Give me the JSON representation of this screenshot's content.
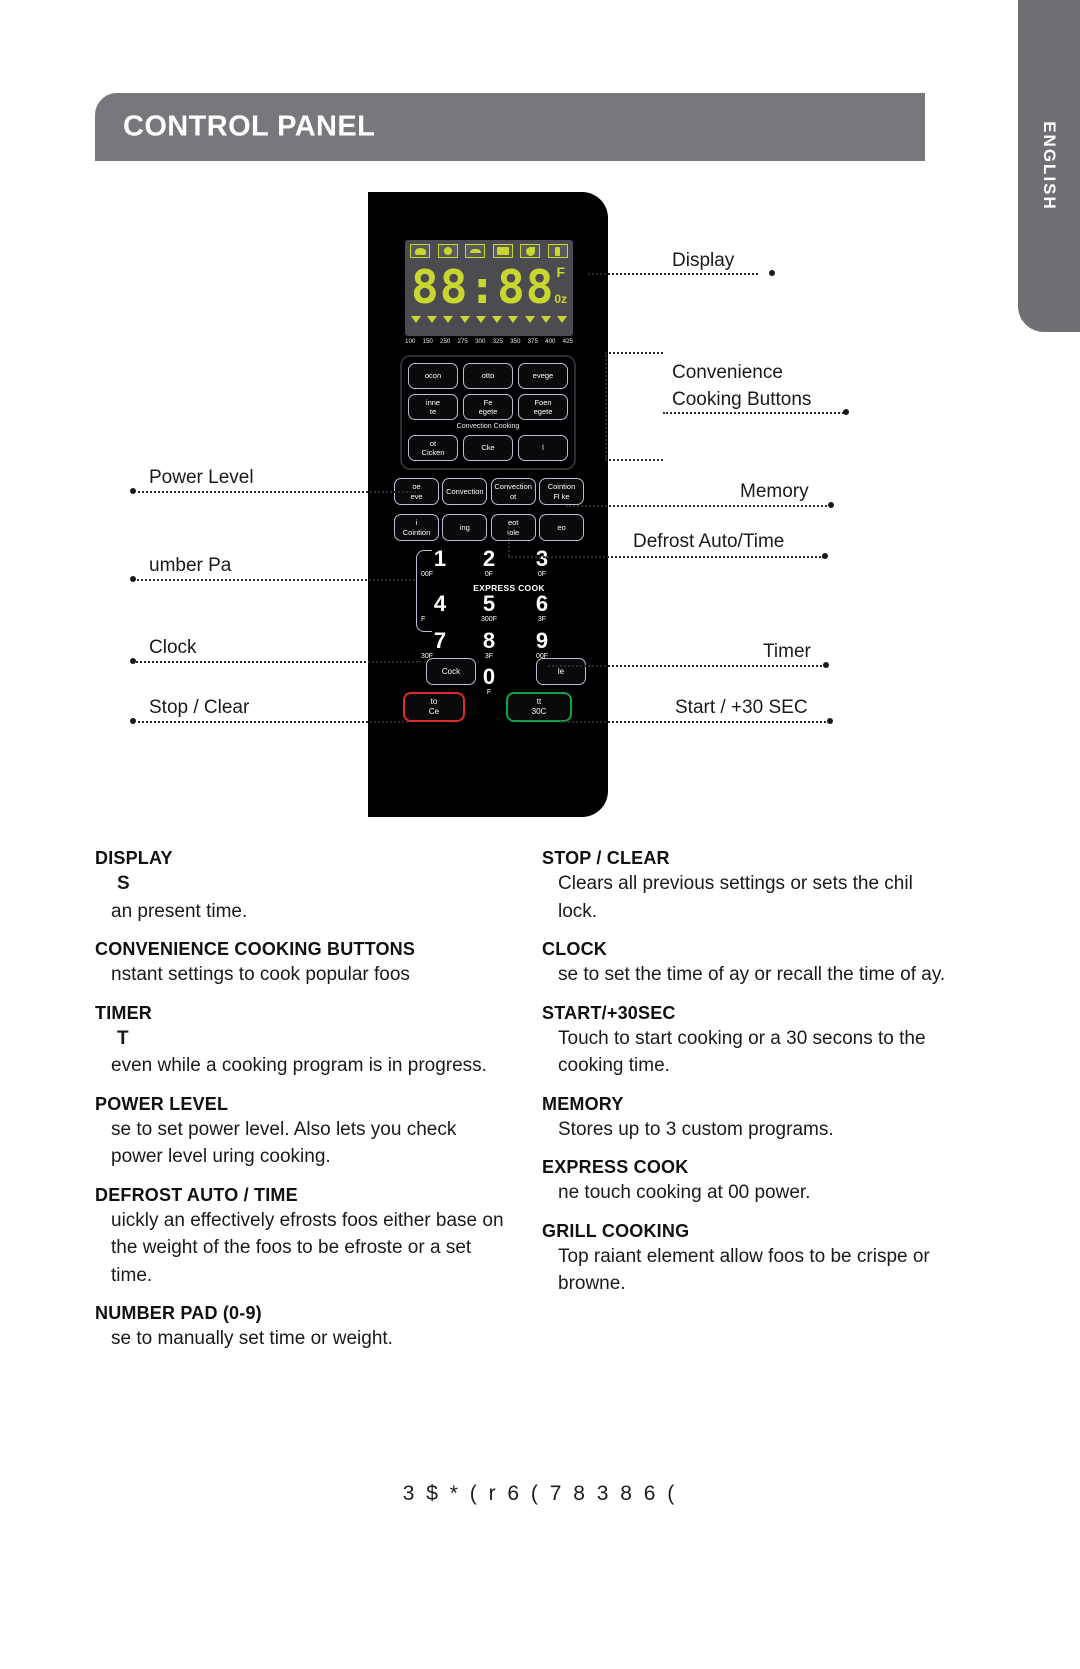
{
  "language_tab": {
    "label": "ENGLISH"
  },
  "header": {
    "title": "CONTROL PANEL"
  },
  "panel": {
    "display": {
      "digits": "88:88",
      "unit_f": "F",
      "unit_oz": "0z",
      "temp_scale": [
        "100",
        "150",
        "250",
        "275",
        "300",
        "325",
        "350",
        "375",
        "400",
        "425"
      ],
      "status_icons": [
        "popcorn-icon",
        "potato-icon",
        "pizza-icon",
        "reheat-icon",
        "beverage-icon",
        "defrost-icon"
      ]
    },
    "convenience_buttons": [
      {
        "line1": "ocon",
        "line2": ""
      },
      {
        "line1": "otto",
        "line2": ""
      },
      {
        "line1": "evege",
        "line2": ""
      },
      {
        "line1": "inne",
        "line2": "te"
      },
      {
        "line1": "Fe",
        "line2": "egete"
      },
      {
        "line1": "Foen",
        "line2": "egete"
      },
      {
        "line1": "ot",
        "line2": "Cicken"
      },
      {
        "line1": "Cke",
        "line2": ""
      },
      {
        "line1": "l",
        "line2": ""
      }
    ],
    "convenience_caption": "Convection Cooking",
    "mid_row_1": [
      {
        "line1": "oe",
        "line2": "eve"
      },
      {
        "line1": "Convection",
        "line2": ""
      },
      {
        "line1": "Convection",
        "line2": "ot"
      },
      {
        "line1": "Cointion",
        "line2": "Fl ke"
      }
    ],
    "mid_row_2": [
      {
        "line1": "i",
        "line2": "Cointion"
      },
      {
        "line1": "ing",
        "line2": ""
      },
      {
        "line1": "eot",
        "line2": "tole"
      },
      {
        "line1": "eo",
        "line2": ""
      }
    ],
    "numpad": [
      {
        "digit": "1",
        "sub": "00F"
      },
      {
        "digit": "2",
        "sub": "0F"
      },
      {
        "digit": "3",
        "sub": "0F"
      },
      {
        "digit": "4",
        "sub": "F"
      },
      {
        "digit": "5",
        "sub": "300F"
      },
      {
        "digit": "6",
        "sub": "3F"
      },
      {
        "digit": "7",
        "sub": "30F"
      },
      {
        "digit": "8",
        "sub": "3F"
      },
      {
        "digit": "9",
        "sub": "00F"
      },
      {
        "digit": "0",
        "sub": "F"
      }
    ],
    "express_cook_label": "EXPRESS COOK",
    "clock_button": "Cock",
    "timer_button": "le",
    "stop_clear_button": {
      "line1": "to",
      "line2": "Ce"
    },
    "start_button": {
      "line1": "tt",
      "line2": "30C"
    }
  },
  "callouts": {
    "display": "Display",
    "convenience_1": "Convenience",
    "convenience_2": "Cooking Buttons",
    "power_level": "Power Level",
    "memory": "Memory",
    "number_pad": "umber Pa",
    "defrost": "Defrost Auto/Time",
    "clock": "Clock",
    "timer": "Timer",
    "stop_clear": "Stop / Clear",
    "start": "Start / +30 SEC"
  },
  "descriptions": {
    "left": [
      {
        "title": "DISPLAY",
        "sub": "S",
        "body": "an present time."
      },
      {
        "title": "CONVENIENCE COOKING BUTTONS",
        "sub": "",
        "body": "nstant settings to cook popular foos"
      },
      {
        "title": "TIMER",
        "sub": "T",
        "body": "even while a cooking program is in progress."
      },
      {
        "title": "POWER LEVEL",
        "sub": "",
        "body": "se to set power level. Also lets you check power level uring cooking."
      },
      {
        "title": "DEFROST  AUTO / TIME",
        "sub": "",
        "body": "uickly an effectively efrosts foos either base on the weight of the foos to be efroste or a set time."
      },
      {
        "title": "NUMBER PAD (0-9)",
        "sub": "",
        "body": "se to manually set time or weight."
      }
    ],
    "right": [
      {
        "title": "STOP / CLEAR",
        "sub": "",
        "body": "Clears all previous settings or sets the chil lock."
      },
      {
        "title": "CLOCK",
        "sub": "",
        "body": "se to set the time of ay or recall the time of ay."
      },
      {
        "title": "START/+30SEC",
        "sub": "",
        "body": "Touch to start cooking or a 30 secons to the cooking time."
      },
      {
        "title": "MEMORY",
        "sub": "",
        "body": "Stores up to 3 custom programs."
      },
      {
        "title": "EXPRESS COOK",
        "sub": "",
        "body": "ne touch cooking at 00 power."
      },
      {
        "title": "GRILL COOKING",
        "sub": "",
        "body": "Top raiant element allow foos to be crispe or browne."
      }
    ]
  },
  "footer": {
    "text": "3 $ * (      r   6 ( 7   8 3      8 6 ("
  },
  "colors": {
    "header_gray": "#76787c",
    "tab_gray": "#6e7074",
    "lcd_green": "#c9d630",
    "stop_red": "#e02b2b",
    "start_green": "#13a049"
  }
}
